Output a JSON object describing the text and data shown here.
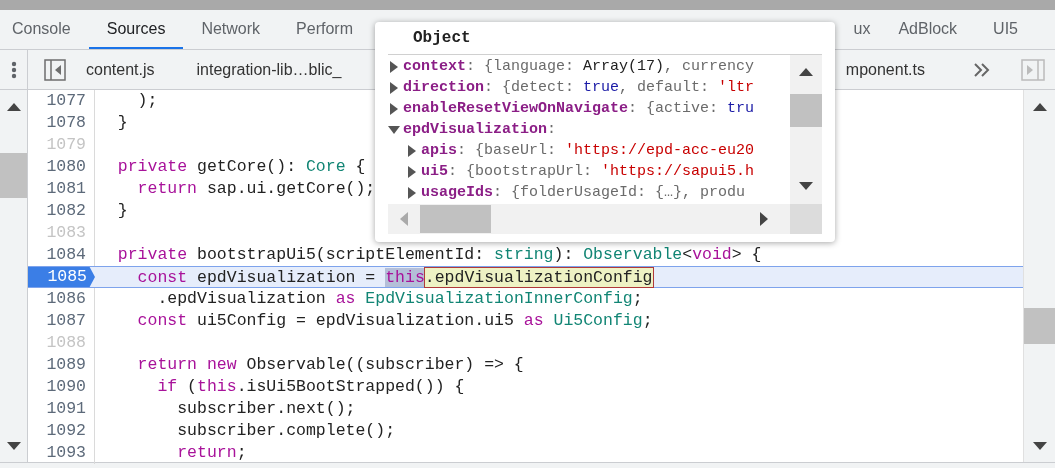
{
  "top_tabs": [
    {
      "label": "Console",
      "selected": false
    },
    {
      "label": "Sources",
      "selected": true
    },
    {
      "label": "Network",
      "selected": false
    },
    {
      "label": "Perform",
      "selected": false
    },
    {
      "label": "ux",
      "selected": false
    },
    {
      "label": "AdBlock",
      "selected": false
    },
    {
      "label": "UI5",
      "selected": false
    }
  ],
  "file_tabs": [
    {
      "label": "content.js"
    },
    {
      "label": "integration-lib…blic_"
    },
    {
      "label": "mponent.ts"
    }
  ],
  "code": [
    {
      "number": "1077",
      "muted": false,
      "breakpoint": false,
      "tokens": [
        {
          "text": "    );",
          "kind": "plain"
        }
      ]
    },
    {
      "number": "1078",
      "muted": false,
      "breakpoint": false,
      "tokens": [
        {
          "text": "  }",
          "kind": "plain"
        }
      ]
    },
    {
      "number": "1079",
      "muted": true,
      "breakpoint": false
    },
    {
      "number": "1080",
      "muted": false,
      "breakpoint": false,
      "tokens": [
        {
          "text": "  private",
          "kind": "keyword"
        },
        {
          "text": " getCore(): ",
          "kind": "plain"
        },
        {
          "text": "Core",
          "kind": "type"
        },
        {
          "text": " {",
          "kind": "plain"
        }
      ]
    },
    {
      "number": "1081",
      "muted": false,
      "breakpoint": false,
      "tokens": [
        {
          "text": "    return",
          "kind": "keyword"
        },
        {
          "text": " sap.ui.getCore();",
          "kind": "plain"
        }
      ]
    },
    {
      "number": "1082",
      "muted": false,
      "breakpoint": false,
      "tokens": [
        {
          "text": "  }",
          "kind": "plain"
        }
      ]
    },
    {
      "number": "1083",
      "muted": true,
      "breakpoint": false
    },
    {
      "number": "1084",
      "muted": false,
      "breakpoint": false,
      "tokens": [
        {
          "text": "  private",
          "kind": "keyword"
        },
        {
          "text": " bootstrapUi5(scriptElementId: ",
          "kind": "plain"
        },
        {
          "text": "string",
          "kind": "type"
        },
        {
          "text": "): ",
          "kind": "plain"
        },
        {
          "text": "Observable",
          "kind": "type"
        },
        {
          "text": "<",
          "kind": "plain"
        },
        {
          "text": "void",
          "kind": "keyword"
        },
        {
          "text": "> {",
          "kind": "plain"
        }
      ]
    },
    {
      "number": "1085",
      "muted": false,
      "breakpoint": true,
      "tokens": [
        {
          "text": "    const",
          "kind": "keyword"
        },
        {
          "text": " epdVisualization = ",
          "kind": "plain"
        },
        {
          "text": "this",
          "kind": "selection"
        },
        {
          "text": ".epdVisualizationConfig",
          "kind": "hover"
        }
      ]
    },
    {
      "number": "1086",
      "muted": false,
      "breakpoint": false,
      "tokens": [
        {
          "text": "      .epdVisualization ",
          "kind": "plain"
        },
        {
          "text": "as ",
          "kind": "keyword"
        },
        {
          "text": "EpdVisualizationInnerConfig",
          "kind": "type"
        },
        {
          "text": ";",
          "kind": "plain"
        }
      ]
    },
    {
      "number": "1087",
      "muted": false,
      "breakpoint": false,
      "tokens": [
        {
          "text": "    const",
          "kind": "keyword"
        },
        {
          "text": " ui5Config = epdVisualization.ui5 ",
          "kind": "plain"
        },
        {
          "text": "as ",
          "kind": "keyword"
        },
        {
          "text": "Ui5Config",
          "kind": "type"
        },
        {
          "text": ";",
          "kind": "plain"
        }
      ]
    },
    {
      "number": "1088",
      "muted": true,
      "breakpoint": false
    },
    {
      "number": "1089",
      "muted": false,
      "breakpoint": false,
      "tokens": [
        {
          "text": "    return new",
          "kind": "keyword"
        },
        {
          "text": " Observable((subscriber) => {",
          "kind": "plain"
        }
      ]
    },
    {
      "number": "1090",
      "muted": false,
      "breakpoint": false,
      "tokens": [
        {
          "text": "      if",
          "kind": "keyword"
        },
        {
          "text": " (",
          "kind": "plain"
        },
        {
          "text": "this",
          "kind": "keyword"
        },
        {
          "text": ".isUi5BootStrapped()) {",
          "kind": "plain"
        }
      ]
    },
    {
      "number": "1091",
      "muted": false,
      "breakpoint": false,
      "tokens": [
        {
          "text": "        subscriber.next();",
          "kind": "plain"
        }
      ]
    },
    {
      "number": "1092",
      "muted": false,
      "breakpoint": false,
      "tokens": [
        {
          "text": "        subscriber.complete();",
          "kind": "plain"
        }
      ]
    },
    {
      "number": "1093",
      "muted": false,
      "breakpoint": false,
      "tokens": [
        {
          "text": "        return",
          "kind": "keyword"
        },
        {
          "text": ";",
          "kind": "plain"
        }
      ]
    }
  ],
  "popover": {
    "title": "Object",
    "rows": [
      {
        "key": "context",
        "expanded": false,
        "value": [
          {
            "text": ": {language: ",
            "kind": "punct"
          },
          {
            "text": "Array(17)",
            "kind": "plain"
          },
          {
            "text": ", currency",
            "kind": "punct"
          }
        ]
      },
      {
        "key": "direction",
        "expanded": false,
        "value": [
          {
            "text": ": {detect: ",
            "kind": "punct"
          },
          {
            "text": "true",
            "kind": "boolean"
          },
          {
            "text": ", default: ",
            "kind": "punct"
          },
          {
            "text": "'ltr",
            "kind": "string"
          }
        ]
      },
      {
        "key": "enableResetViewOnNavigate",
        "expanded": false,
        "value": [
          {
            "text": ": {active: ",
            "kind": "punct"
          },
          {
            "text": "tru",
            "kind": "boolean"
          }
        ]
      },
      {
        "key": "epdVisualization",
        "expanded": true,
        "value": [
          {
            "text": ":",
            "kind": "punct"
          }
        ],
        "children": [
          {
            "key": "apis",
            "expanded": false,
            "value": [
              {
                "text": ": {baseUrl: ",
                "kind": "punct"
              },
              {
                "text": "'https://epd-acc-eu20",
                "kind": "string"
              }
            ]
          },
          {
            "key": "ui5",
            "expanded": false,
            "value": [
              {
                "text": ": {bootstrapUrl: ",
                "kind": "punct"
              },
              {
                "text": "'https://sapui5.h",
                "kind": "string"
              }
            ]
          },
          {
            "key": "usageIds",
            "expanded": false,
            "value": [
              {
                "text": ": {folderUsageId: {…}, produ",
                "kind": "punct"
              }
            ]
          }
        ]
      }
    ]
  }
}
